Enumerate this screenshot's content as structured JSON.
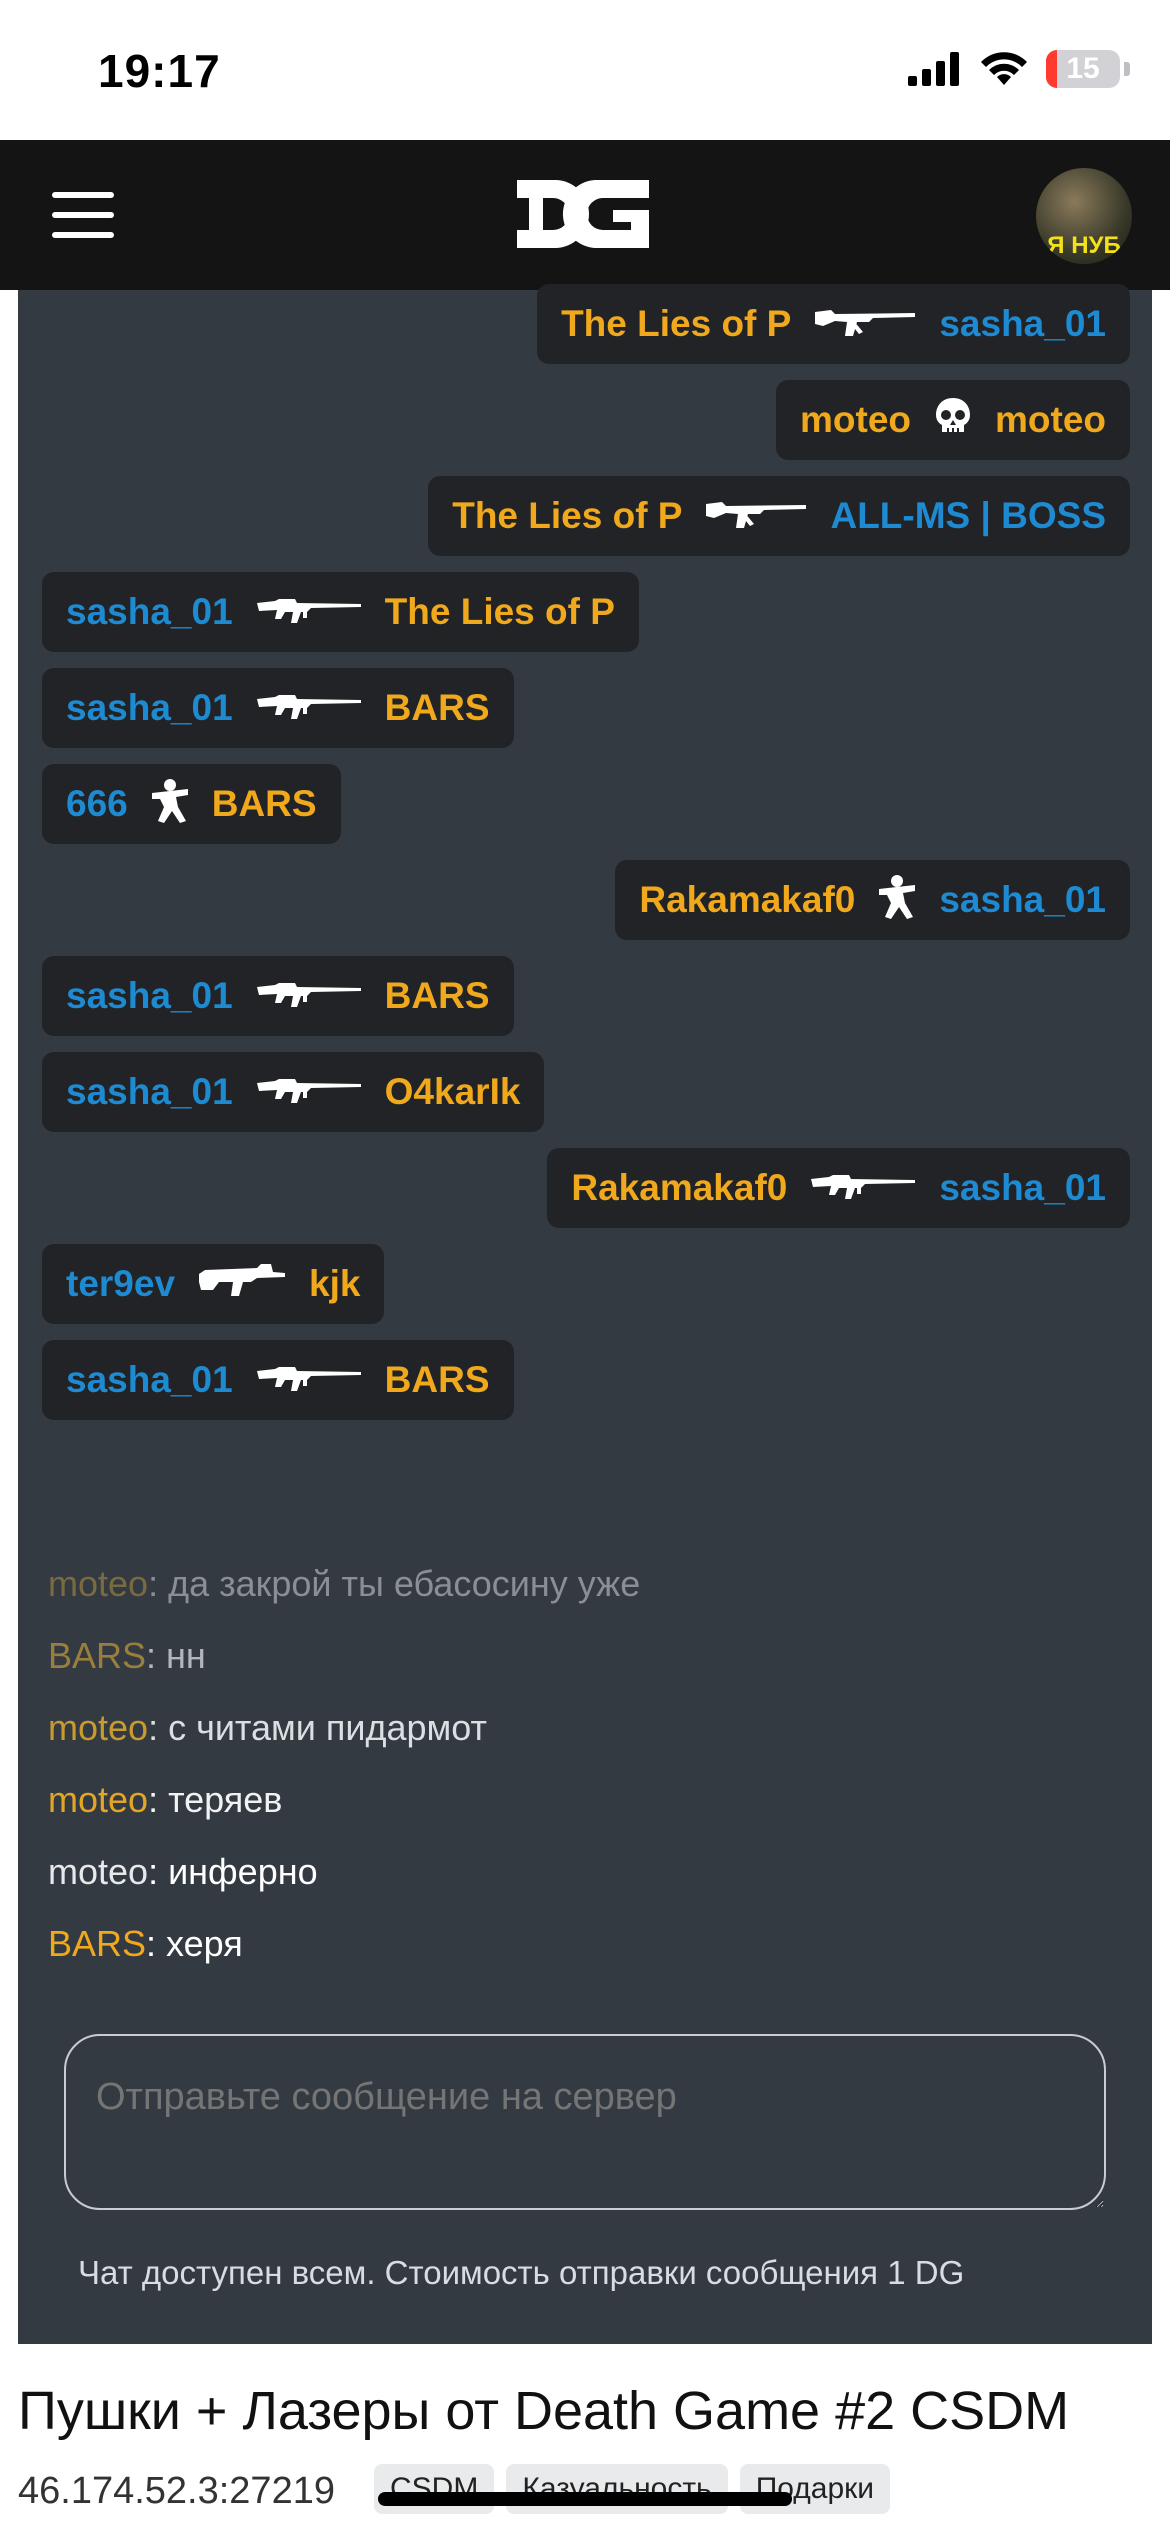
{
  "status_bar": {
    "time": "19:17",
    "battery": "15",
    "battery_level": 0.15
  },
  "header": {
    "logo": "DG",
    "avatar_text": "Я НУБ"
  },
  "kill_feed": [
    {
      "align": "right",
      "killer": "The Lies of P",
      "killer_color": "yellow",
      "weapon": "ak47-rifle-icon",
      "victim": "sasha_01",
      "victim_color": "blue"
    },
    {
      "align": "right",
      "killer": "moteo",
      "killer_color": "yellow",
      "weapon": "skull-icon",
      "victim": "moteo",
      "victim_color": "yellow"
    },
    {
      "align": "right",
      "killer": "The Lies of P",
      "killer_color": "yellow",
      "weapon": "ak47-rifle-icon",
      "victim": "ALL-MS | BOSS",
      "victim_color": "blue"
    },
    {
      "align": "left",
      "killer": "sasha_01",
      "killer_color": "blue",
      "weapon": "m4a1-rifle-icon",
      "victim": "The Lies of P",
      "victim_color": "yellow"
    },
    {
      "align": "left",
      "killer": "sasha_01",
      "killer_color": "blue",
      "weapon": "m4a1-rifle-icon",
      "victim": "BARS",
      "victim_color": "yellow"
    },
    {
      "align": "left",
      "killer": "666",
      "killer_color": "blue",
      "weapon": "rocket-launcher-icon",
      "victim": "BARS",
      "victim_color": "yellow"
    },
    {
      "align": "right",
      "killer": "Rakamakaf0",
      "killer_color": "yellow",
      "weapon": "rocket-launcher-icon",
      "victim": "sasha_01",
      "victim_color": "blue"
    },
    {
      "align": "left",
      "killer": "sasha_01",
      "killer_color": "blue",
      "weapon": "m4a1-rifle-icon",
      "victim": "BARS",
      "victim_color": "yellow"
    },
    {
      "align": "left",
      "killer": "sasha_01",
      "killer_color": "blue",
      "weapon": "m4a1-rifle-icon",
      "victim": "O4karIk",
      "victim_color": "yellow"
    },
    {
      "align": "right",
      "killer": "Rakamakaf0",
      "killer_color": "yellow",
      "weapon": "m4a1-rifle-icon",
      "victim": "sasha_01",
      "victim_color": "blue"
    },
    {
      "align": "left",
      "killer": "ter9ev",
      "killer_color": "blue",
      "weapon": "famas-rifle-icon",
      "victim": "kjk",
      "victim_color": "yellow"
    },
    {
      "align": "left",
      "killer": "sasha_01",
      "killer_color": "blue",
      "weapon": "m4a1-rifle-icon",
      "victim": "BARS",
      "victim_color": "yellow"
    }
  ],
  "chat_messages": [
    {
      "name": "moteo",
      "name_color": "#7a6a3f",
      "text": "да закрой ты ебасосину уже",
      "text_color": "#8a8f95"
    },
    {
      "name": "BARS",
      "name_color": "#9a7e3e",
      "text": "нн",
      "text_color": "#b3b7bc"
    },
    {
      "name": "moteo",
      "name_color": "#c99a2e",
      "text": "с читами пидармот",
      "text_color": "#dcdfe2"
    },
    {
      "name": "moteo",
      "name_color": "#e3a526",
      "text": "теряев",
      "text_color": "#f0f2f4"
    },
    {
      "name": "moteo",
      "name_color": "#e6e8ea",
      "text": "инферно",
      "text_color": "#ffffff"
    },
    {
      "name": "BARS",
      "name_color": "#f0a81c",
      "text": "херя",
      "text_color": "#ffffff"
    }
  ],
  "chat_input": {
    "placeholder": "Отправьте сообщение на сервер",
    "value": ""
  },
  "chat_note": "Чат доступен всем. Стоимость отправки сообщения 1 DG",
  "server": {
    "title": "Пушки + Лазеры от Death Game #2 CSDM",
    "address": "46.174.52.3:27219",
    "tags": [
      "CSDM",
      "Казуальность",
      "Подарки"
    ]
  },
  "colors": {
    "nav_bg": "#141414",
    "panel_bg": "#343a42",
    "feed_bg": "#212327",
    "accent_yellow": "#f0a81c",
    "accent_blue": "#1e8ad1"
  }
}
